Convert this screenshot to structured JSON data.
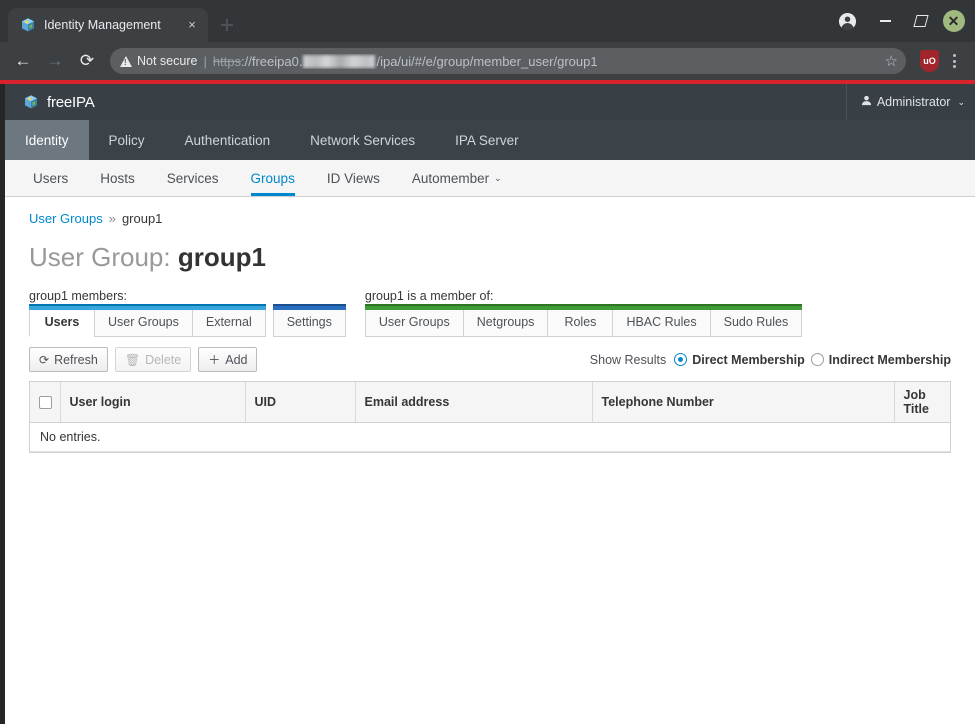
{
  "browser": {
    "tab": {
      "title": "Identity Management",
      "favicon": "freeipa-cube-icon",
      "close_label": "×"
    },
    "nav": {
      "back": "←",
      "forward": "→",
      "reload": "⟳"
    },
    "omnibox": {
      "security_label": "Not secure",
      "separator": "|",
      "url_scheme": "https",
      "url_after_scheme": "://freeipa0.",
      "url_redacted": true,
      "url_tail": "/ipa/ui/#/e/group/member_user/group1",
      "bookmark_icon": "☆"
    },
    "extension": {
      "label": "uO"
    },
    "window": {
      "minimize": "−",
      "maximize": "□",
      "close": "✕"
    },
    "accent_red": "#d9232c"
  },
  "ipa": {
    "brand": "freeIPA",
    "user_menu": {
      "label": "Administrator",
      "caret": "⌄"
    },
    "nav_primary": [
      {
        "label": "Identity",
        "active": true
      },
      {
        "label": "Policy",
        "active": false
      },
      {
        "label": "Authentication",
        "active": false
      },
      {
        "label": "Network Services",
        "active": false
      },
      {
        "label": "IPA Server",
        "active": false
      }
    ],
    "nav_secondary": [
      {
        "label": "Users",
        "active": false,
        "caret": ""
      },
      {
        "label": "Hosts",
        "active": false,
        "caret": ""
      },
      {
        "label": "Services",
        "active": false,
        "caret": ""
      },
      {
        "label": "Groups",
        "active": true,
        "caret": ""
      },
      {
        "label": "ID Views",
        "active": false,
        "caret": ""
      },
      {
        "label": "Automember",
        "active": false,
        "caret": "⌄"
      }
    ],
    "breadcrumb": {
      "parent": "User Groups",
      "separator": "»",
      "current": "group1"
    },
    "page_title": {
      "prefix": "User Group:",
      "name": "group1"
    },
    "facets": {
      "members": {
        "label": "group1 members:",
        "color": "#39a5dc",
        "tabs": [
          {
            "label": "Users",
            "active": true
          },
          {
            "label": "User Groups",
            "active": false
          },
          {
            "label": "External",
            "active": false
          }
        ],
        "settings_tab": {
          "label": "Settings",
          "active": false,
          "color": "#2a6ec0"
        }
      },
      "memberof": {
        "label": "group1 is a member of:",
        "color": "#3f9c35",
        "tabs": [
          {
            "label": "User Groups",
            "active": false
          },
          {
            "label": "Netgroups",
            "active": false
          },
          {
            "label": "Roles",
            "active": false
          },
          {
            "label": "HBAC Rules",
            "active": false
          },
          {
            "label": "Sudo Rules",
            "active": false
          }
        ]
      }
    },
    "toolbar": {
      "refresh": {
        "label": "Refresh",
        "icon": "⟳",
        "disabled": false
      },
      "delete": {
        "label": "Delete",
        "icon": "🗑",
        "disabled": true
      },
      "add": {
        "label": "Add",
        "icon": "＋",
        "disabled": false
      }
    },
    "results_control": {
      "label": "Show Results",
      "options": [
        {
          "label": "Direct Membership",
          "selected": true
        },
        {
          "label": "Indirect Membership",
          "selected": false
        }
      ]
    },
    "table": {
      "columns": [
        "User login",
        "UID",
        "Email address",
        "Telephone Number",
        "Job Title"
      ],
      "rows": [],
      "empty_message": "No entries."
    }
  }
}
